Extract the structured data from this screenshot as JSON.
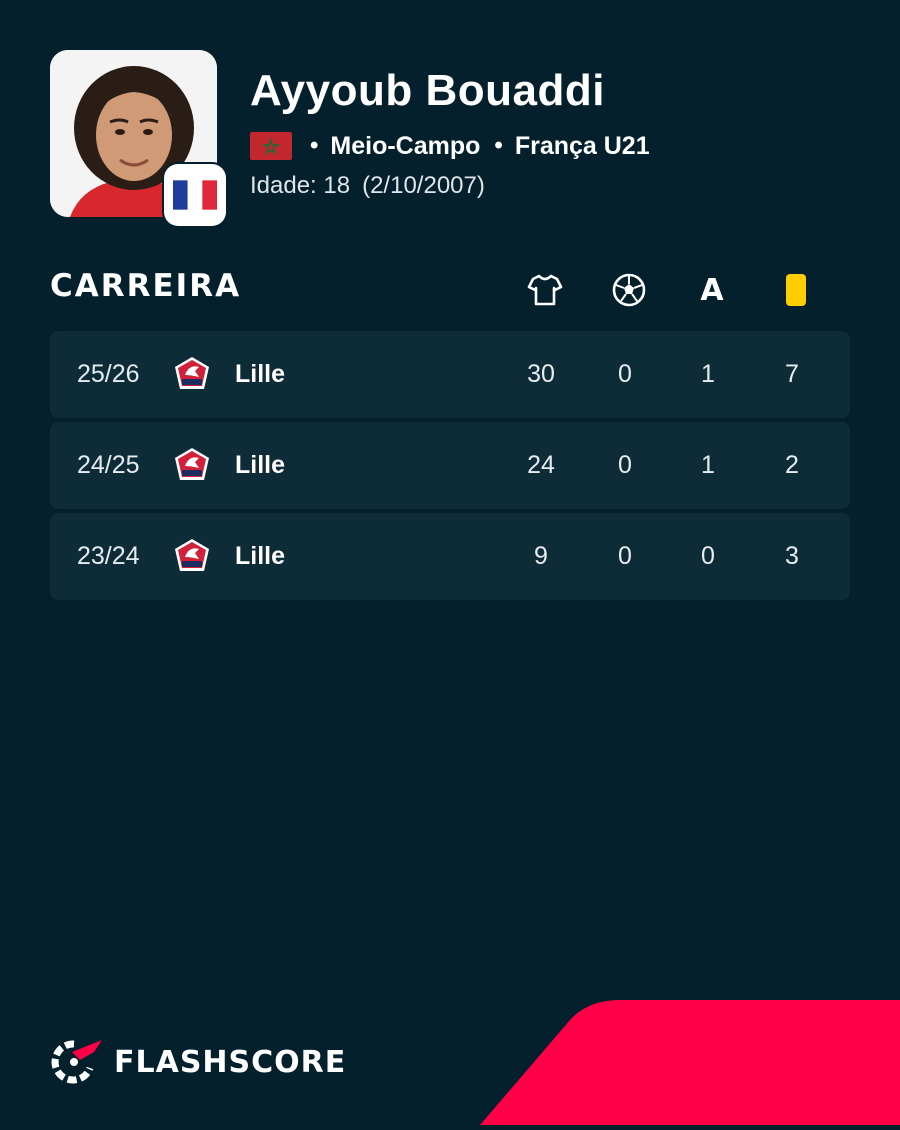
{
  "player": {
    "name": "Ayyoub Bouaddi",
    "position": "Meio-Campo",
    "team": "França U21",
    "age_label": "Idade: 18",
    "birth_date": "(2/10/2007)",
    "nationality_flag": "morocco-flag-icon",
    "team_flag": "france-flag-icon"
  },
  "career": {
    "title": "CARREIRA",
    "columns": [
      {
        "icon": "shirt-icon",
        "meaning": "appearances"
      },
      {
        "icon": "football-icon",
        "meaning": "goals"
      },
      {
        "label": "A",
        "meaning": "assists"
      },
      {
        "icon": "yellow-card-icon",
        "meaning": "yellow cards"
      }
    ],
    "rows": [
      {
        "season": "25/26",
        "club": "Lille",
        "apps": "30",
        "goals": "0",
        "assists": "1",
        "yellow": "7"
      },
      {
        "season": "24/25",
        "club": "Lille",
        "apps": "24",
        "goals": "0",
        "assists": "1",
        "yellow": "2"
      },
      {
        "season": "23/24",
        "club": "Lille",
        "apps": "9",
        "goals": "0",
        "assists": "0",
        "yellow": "3"
      }
    ]
  },
  "brand": {
    "name": "FLASHSCORE"
  },
  "colors": {
    "background": "#03202c",
    "row_background": "#0e2c38",
    "accent": "#ff0046",
    "yellow_card": "#ffcd00"
  }
}
